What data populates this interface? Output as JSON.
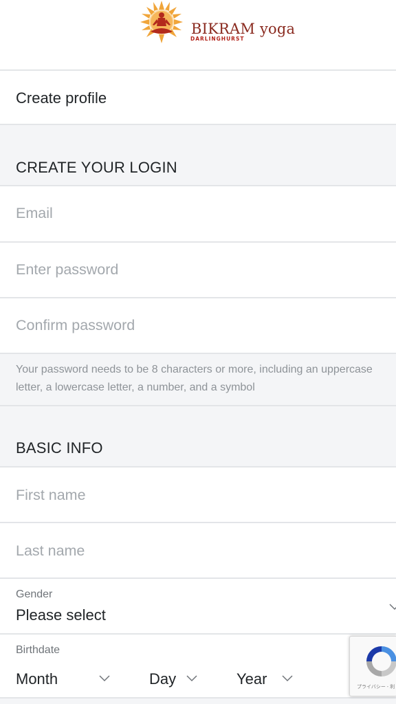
{
  "logo": {
    "brand": "BIKRAM yoga",
    "location": "DARLINGHURST",
    "icon": "sun-meditation-icon",
    "color": "#8a2a1f"
  },
  "header": {
    "title": "Create profile"
  },
  "login_section": {
    "heading": "CREATE YOUR LOGIN",
    "email_placeholder": "Email",
    "password_placeholder": "Enter password",
    "confirm_placeholder": "Confirm password",
    "password_hint": "Your password needs to be 8 characters or more, including an uppercase letter, a lowercase letter, a number, and a symbol"
  },
  "basic_info": {
    "heading": "BASIC INFO",
    "first_name_placeholder": "First name",
    "last_name_placeholder": "Last name",
    "gender_label": "Gender",
    "gender_value": "Please select",
    "birthdate_label": "Birthdate",
    "month": "Month",
    "day": "Day",
    "year": "Year"
  },
  "recaptcha": {
    "note": "プライバシー - 利",
    "icon": "recaptcha-icon"
  }
}
